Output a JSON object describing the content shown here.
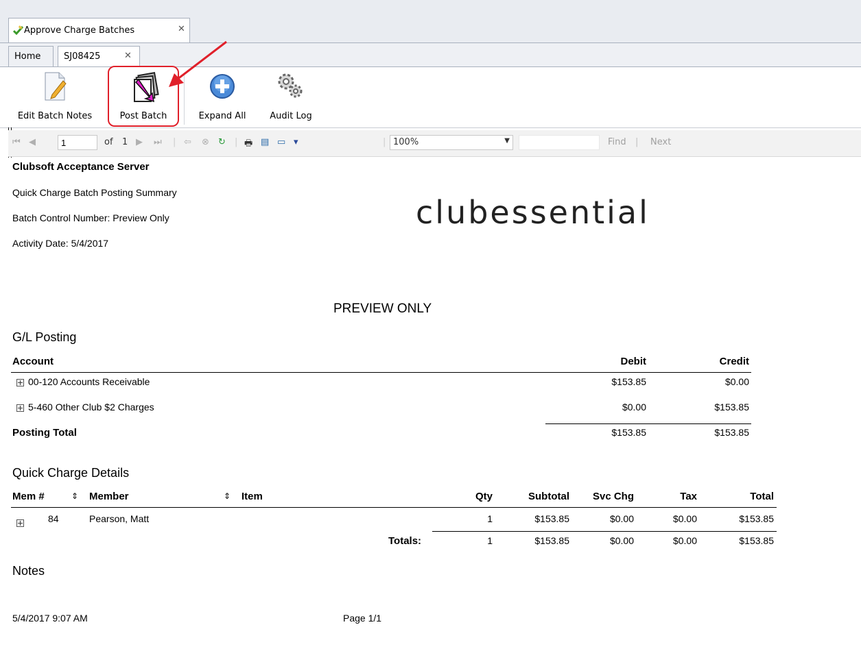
{
  "doc_tab": {
    "title": "Approve Charge Batches"
  },
  "sub_tabs": [
    {
      "label": "Home"
    },
    {
      "label": "SJ08425"
    }
  ],
  "ribbon": {
    "edit_notes": "Edit Batch Notes",
    "post_batch": "Post Batch",
    "expand_all": "Expand All",
    "audit_log": "Audit Log"
  },
  "toolbar": {
    "page": "1",
    "of": "of",
    "total_pages": "1",
    "zoom": "100%",
    "find": "Find",
    "sep": "|",
    "next": "Next"
  },
  "report": {
    "server": "Clubsoft Acceptance Server",
    "summary_title": "Quick Charge Batch Posting Summary",
    "batch_control": "Batch Control Number: Preview Only",
    "activity_date": "Activity Date: 5/4/2017",
    "logo": "clubessential",
    "preview_only": "PREVIEW ONLY",
    "gl": {
      "section": "G/L Posting",
      "col_account": "Account",
      "col_debit": "Debit",
      "col_credit": "Credit",
      "rows": [
        {
          "account": "00-120 Accounts Receivable",
          "debit": "$153.85",
          "credit": "$0.00"
        },
        {
          "account": "5-460 Other Club $2 Charges",
          "debit": "$0.00",
          "credit": "$153.85"
        }
      ],
      "total_label": "Posting Total",
      "total_debit": "$153.85",
      "total_credit": "$153.85"
    },
    "qc": {
      "section": "Quick Charge Details",
      "cols": {
        "mem": "Mem #",
        "member": "Member",
        "item": "Item",
        "qty": "Qty",
        "subtotal": "Subtotal",
        "svc": "Svc Chg",
        "tax": "Tax",
        "total": "Total"
      },
      "row": {
        "mem": "84",
        "member": "Pearson, Matt",
        "qty": "1",
        "subtotal": "$153.85",
        "svc": "$0.00",
        "tax": "$0.00",
        "total": "$153.85"
      },
      "totals": {
        "label": "Totals:",
        "qty": "1",
        "subtotal": "$153.85",
        "svc": "$0.00",
        "tax": "$0.00",
        "total": "$153.85"
      }
    },
    "notes": "Notes",
    "footer_date": "5/4/2017 9:07 AM",
    "footer_page": "Page 1/1"
  }
}
